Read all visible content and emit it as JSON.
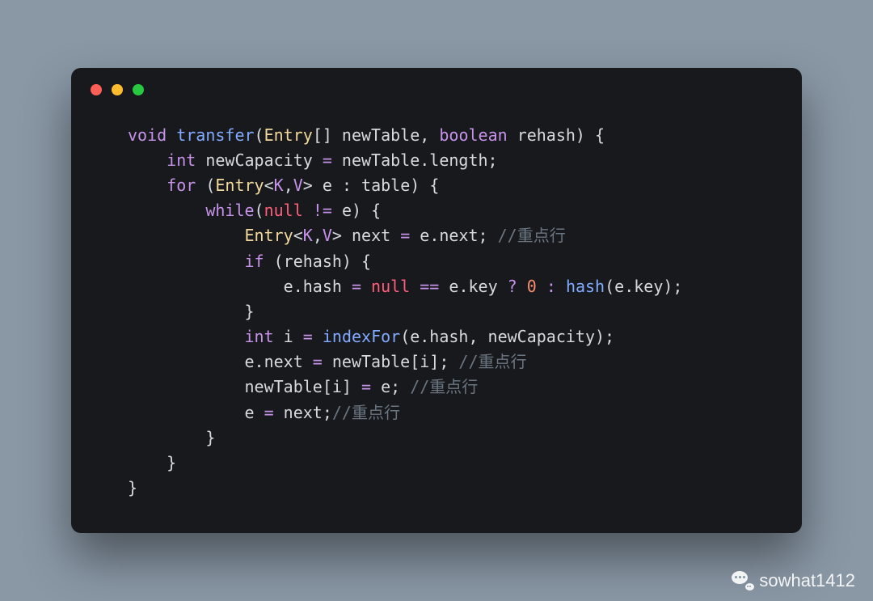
{
  "code": {
    "tokens": [
      [
        {
          "t": "void ",
          "c": "kw"
        },
        {
          "t": "transfer",
          "c": "fn"
        },
        {
          "t": "(",
          "c": "d"
        },
        {
          "t": "Entry",
          "c": "ty"
        },
        {
          "t": "[] newTable, ",
          "c": "d"
        },
        {
          "t": "boolean ",
          "c": "kw"
        },
        {
          "t": "rehash) {",
          "c": "d"
        }
      ],
      [
        {
          "t": "    ",
          "c": "d"
        },
        {
          "t": "int ",
          "c": "kw"
        },
        {
          "t": "newCapacity ",
          "c": "d"
        },
        {
          "t": "=",
          "c": "op"
        },
        {
          "t": " newTable.length;",
          "c": "d"
        }
      ],
      [
        {
          "t": "    ",
          "c": "d"
        },
        {
          "t": "for ",
          "c": "kw"
        },
        {
          "t": "(",
          "c": "d"
        },
        {
          "t": "Entry",
          "c": "ty"
        },
        {
          "t": "<",
          "c": "d"
        },
        {
          "t": "K",
          "c": "gn"
        },
        {
          "t": ",",
          "c": "d"
        },
        {
          "t": "V",
          "c": "gn"
        },
        {
          "t": "> e : table) {",
          "c": "d"
        }
      ],
      [
        {
          "t": "        ",
          "c": "d"
        },
        {
          "t": "while",
          "c": "kw"
        },
        {
          "t": "(",
          "c": "d"
        },
        {
          "t": "null",
          "c": "nu"
        },
        {
          "t": " ",
          "c": "d"
        },
        {
          "t": "!=",
          "c": "op"
        },
        {
          "t": " e) {",
          "c": "d"
        }
      ],
      [
        {
          "t": "            ",
          "c": "d"
        },
        {
          "t": "Entry",
          "c": "ty"
        },
        {
          "t": "<",
          "c": "d"
        },
        {
          "t": "K",
          "c": "gn"
        },
        {
          "t": ",",
          "c": "d"
        },
        {
          "t": "V",
          "c": "gn"
        },
        {
          "t": "> next ",
          "c": "d"
        },
        {
          "t": "=",
          "c": "op"
        },
        {
          "t": " e.next; ",
          "c": "d"
        },
        {
          "t": "//重点行",
          "c": "cm"
        }
      ],
      [
        {
          "t": "            ",
          "c": "d"
        },
        {
          "t": "if ",
          "c": "kw"
        },
        {
          "t": "(rehash) {",
          "c": "d"
        }
      ],
      [
        {
          "t": "                e.hash ",
          "c": "d"
        },
        {
          "t": "=",
          "c": "op"
        },
        {
          "t": " ",
          "c": "d"
        },
        {
          "t": "null",
          "c": "nu"
        },
        {
          "t": " ",
          "c": "d"
        },
        {
          "t": "==",
          "c": "op"
        },
        {
          "t": " e.key ",
          "c": "d"
        },
        {
          "t": "?",
          "c": "op"
        },
        {
          "t": " ",
          "c": "d"
        },
        {
          "t": "0",
          "c": "nm"
        },
        {
          "t": " ",
          "c": "d"
        },
        {
          "t": ":",
          "c": "op"
        },
        {
          "t": " ",
          "c": "d"
        },
        {
          "t": "hash",
          "c": "fn"
        },
        {
          "t": "(e.key);",
          "c": "d"
        }
      ],
      [
        {
          "t": "            }",
          "c": "d"
        }
      ],
      [
        {
          "t": "            ",
          "c": "d"
        },
        {
          "t": "int ",
          "c": "kw"
        },
        {
          "t": "i ",
          "c": "d"
        },
        {
          "t": "=",
          "c": "op"
        },
        {
          "t": " ",
          "c": "d"
        },
        {
          "t": "indexFor",
          "c": "fn"
        },
        {
          "t": "(e.hash, newCapacity);",
          "c": "d"
        }
      ],
      [
        {
          "t": "            e.next ",
          "c": "d"
        },
        {
          "t": "=",
          "c": "op"
        },
        {
          "t": " newTable[i]; ",
          "c": "d"
        },
        {
          "t": "//重点行",
          "c": "cm"
        }
      ],
      [
        {
          "t": "            newTable[i] ",
          "c": "d"
        },
        {
          "t": "=",
          "c": "op"
        },
        {
          "t": " e; ",
          "c": "d"
        },
        {
          "t": "//重点行",
          "c": "cm"
        }
      ],
      [
        {
          "t": "            e ",
          "c": "d"
        },
        {
          "t": "=",
          "c": "op"
        },
        {
          "t": " next;",
          "c": "d"
        },
        {
          "t": "//重点行",
          "c": "cm"
        }
      ],
      [
        {
          "t": "        }",
          "c": "d"
        }
      ],
      [
        {
          "t": "    }",
          "c": "d"
        }
      ],
      [
        {
          "t": "}",
          "c": "d"
        }
      ]
    ]
  },
  "watermark": {
    "text": "sowhat1412"
  }
}
